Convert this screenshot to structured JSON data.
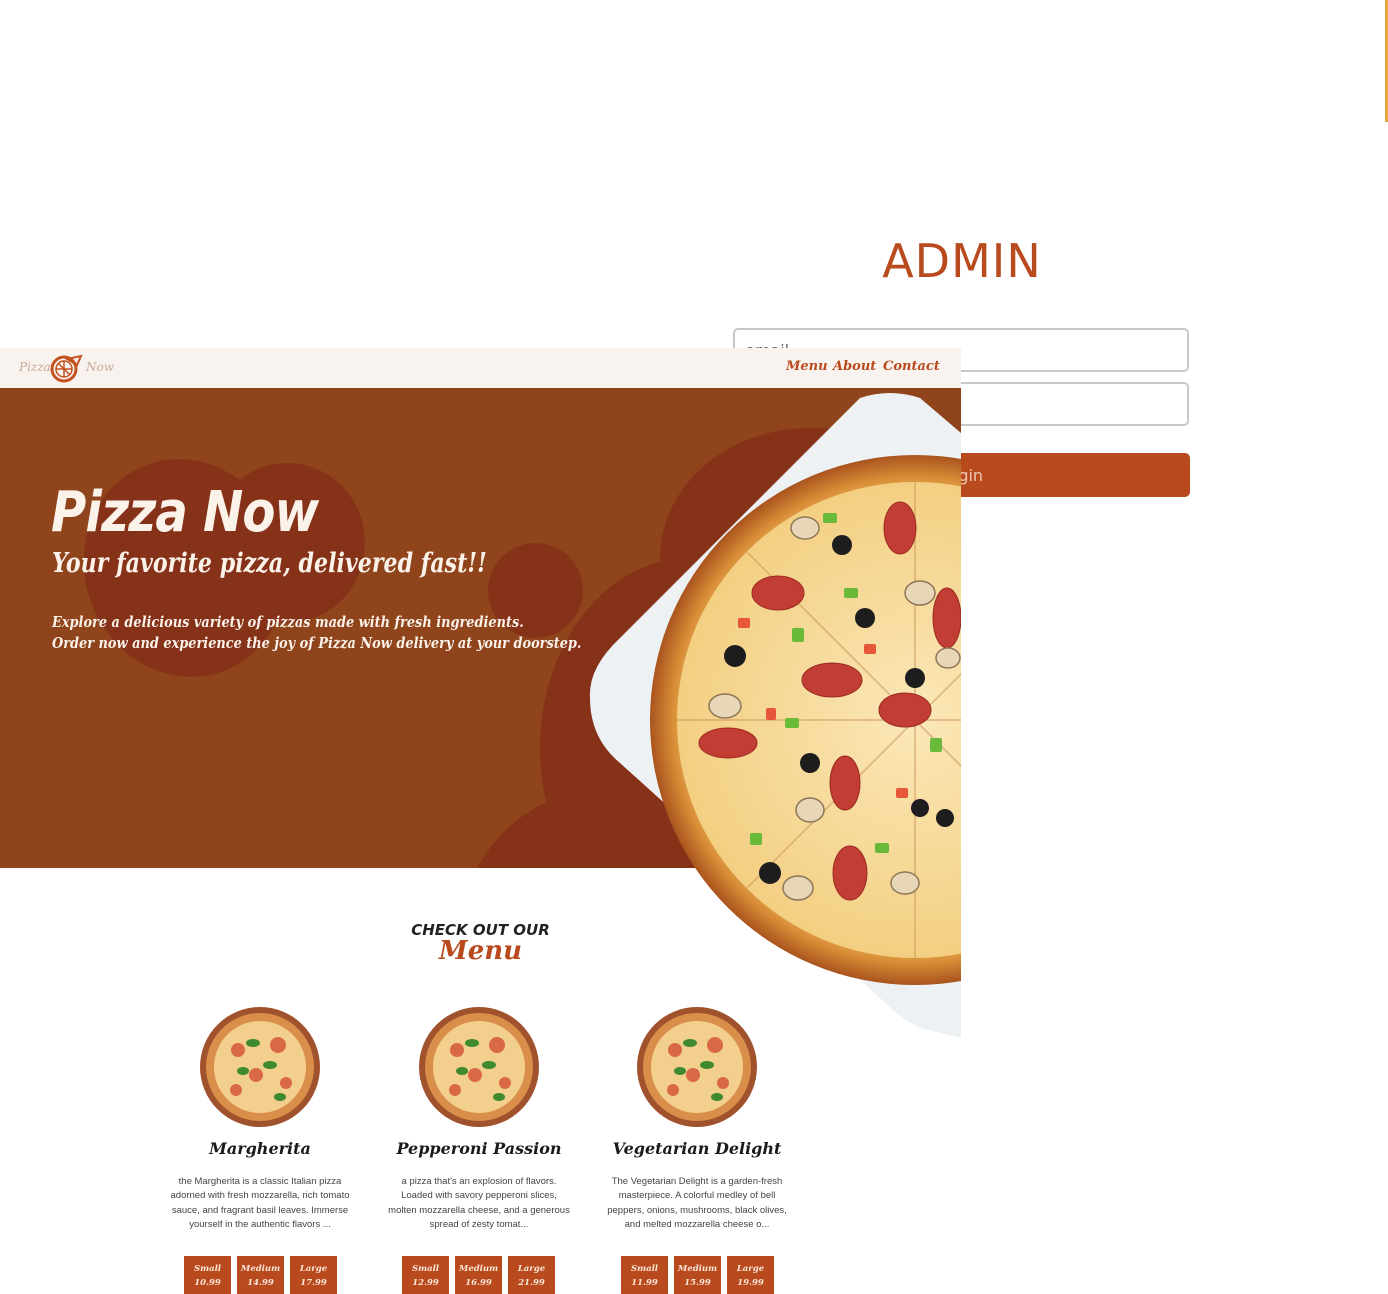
{
  "admin": {
    "title": "ADMIN",
    "email_placeholder": "email",
    "password_placeholder": "",
    "login_label": "Login"
  },
  "site": {
    "logo": {
      "left": "Pizza",
      "right": "Now",
      "icon": "pizza-slice-logo-icon"
    },
    "nav": [
      {
        "label": "Menu"
      },
      {
        "label": "About"
      },
      {
        "label": "Contact"
      }
    ],
    "hero": {
      "title": "Pizza Now",
      "subtitle": "Your favorite pizza, delivered fast!!",
      "line1": "Explore a delicious variety of pizzas made with fresh ingredients.",
      "line2": "Order now and experience the joy of Pizza Now delivery at your doorstep."
    },
    "menu": {
      "heading_small": "CHECK OUT OUR",
      "heading_big": "Menu",
      "items": [
        {
          "name": "Margherita",
          "description": "the Margherita is a classic Italian pizza adorned with fresh mozzarella, rich tomato sauce, and fragrant basil leaves. Immerse yourself in the authentic flavors ...",
          "sizes": [
            {
              "label": "Small",
              "price": "10.99"
            },
            {
              "label": "Medium",
              "price": "14.99"
            },
            {
              "label": "Large",
              "price": "17.99"
            }
          ]
        },
        {
          "name": "Pepperoni Passion",
          "description": "a pizza that's an explosion of flavors. Loaded with savory pepperoni slices, molten mozzarella cheese, and a generous spread of zesty tomat...",
          "sizes": [
            {
              "label": "Small",
              "price": "12.99"
            },
            {
              "label": "Medium",
              "price": "16.99"
            },
            {
              "label": "Large",
              "price": "21.99"
            }
          ]
        },
        {
          "name": "Vegetarian Delight",
          "description": "The Vegetarian Delight is a garden-fresh masterpiece. A colorful medley of bell peppers, onions, mushrooms, black olives, and melted mozzarella cheese o...",
          "sizes": [
            {
              "label": "Small",
              "price": "11.99"
            },
            {
              "label": "Medium",
              "price": "15.99"
            },
            {
              "label": "Large",
              "price": "19.99"
            }
          ]
        }
      ]
    }
  },
  "colors": {
    "brand": "#b94a1d",
    "hero_bg": "#8f441b",
    "nav_bg": "#f9f3ef",
    "accent": "#e2a43b"
  }
}
